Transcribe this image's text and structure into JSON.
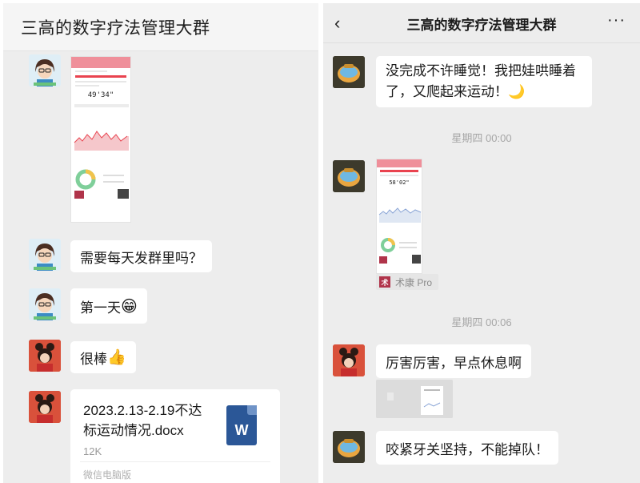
{
  "left": {
    "title": "三高的数字疗法管理大群",
    "shot": {
      "total": "49'34\""
    },
    "messages": [
      {
        "text": "需要每天发群里吗？"
      },
      {
        "text": "第一天",
        "emoji": "😁"
      },
      {
        "text": "很棒",
        "emoji": "👍"
      }
    ],
    "file": {
      "name": "2023.2.13-2.19不达标运动情况.docx",
      "size": "12K",
      "source": "微信电脑版",
      "icon_letter": "W"
    }
  },
  "right": {
    "title": "三高的数字疗法管理大群",
    "back_icon": "‹",
    "more_icon": "···",
    "messages": [
      {
        "text": "没完成不许睡觉！我把娃哄睡着了，又爬起来运动！🌙"
      },
      {
        "text": "厉害厉害，早点休息啊"
      },
      {
        "text": "咬紧牙关坚持，不能掉队！"
      }
    ],
    "time1": "星期四 00:00",
    "time2": "星期四 00:06",
    "shot": {
      "total": "58'02\""
    },
    "sukang": {
      "logo": "术",
      "label": "术康 Pro"
    }
  },
  "colors": {
    "accent_red": "#e9434f",
    "word_blue": "#2b5797",
    "bg": "#ededed"
  }
}
